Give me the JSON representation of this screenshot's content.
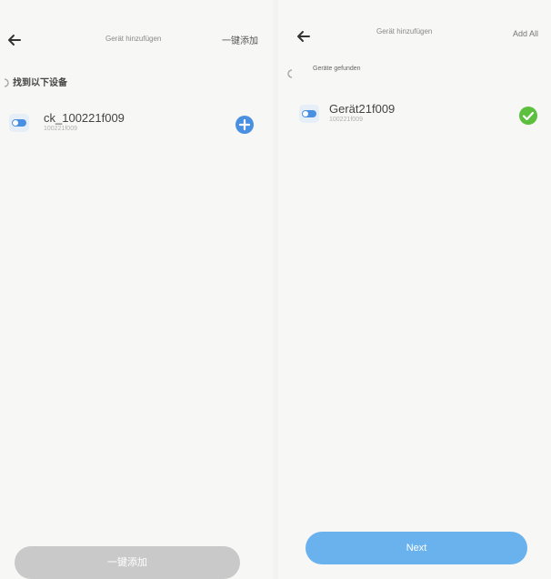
{
  "left_screen": {
    "header": {
      "title": "Gerät hinzufügen",
      "action": "一键添加"
    },
    "section_label": "找到以下设备",
    "device": {
      "name": "ck_100221f009",
      "id": "100221f009"
    },
    "bottom_button": "一键添加"
  },
  "right_screen": {
    "header": {
      "title": "Gerät hinzufügen",
      "action": "Add All"
    },
    "section_label": "Geräte gefunden",
    "device": {
      "name": "Gerät21f009",
      "id": "100221f009"
    },
    "bottom_button": "Next"
  },
  "colors": {
    "accent_blue": "#4a90e2",
    "success_green": "#5cbf3e",
    "button_blue": "#6ab2ee",
    "button_disabled": "#c9c9c9"
  },
  "icons": {
    "back": "arrow-left-icon",
    "spinner": "loading-spinner-icon",
    "device": "smart-switch-icon",
    "add": "plus-circle-icon",
    "added": "check-circle-icon"
  }
}
